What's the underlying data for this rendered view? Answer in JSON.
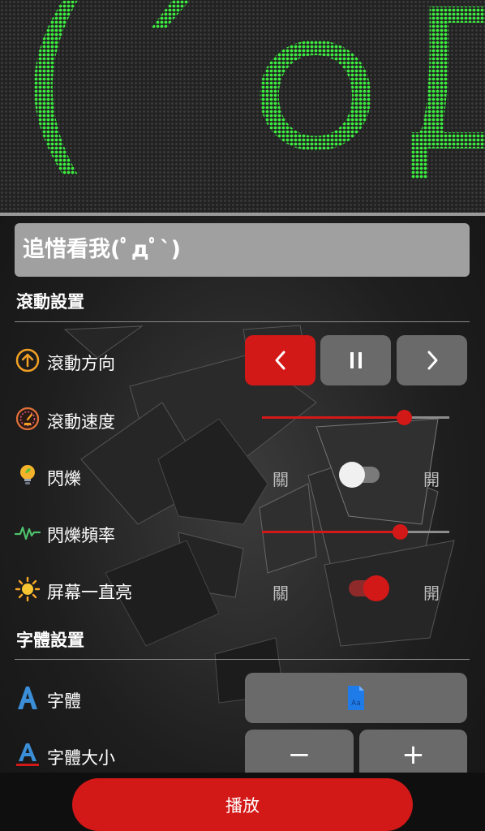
{
  "led_display": {
    "text": "(´ｏДｏ`)"
  },
  "message_input": {
    "value": "追惜看我(ﾟдﾟ`)"
  },
  "scroll_settings": {
    "title": "滾動設置",
    "direction": {
      "label": "滾動方向",
      "selected": "left"
    },
    "speed": {
      "label": "滾動速度",
      "value": 0.8
    },
    "blink": {
      "label": "閃爍",
      "off_label": "關",
      "on_label": "開",
      "state": "off"
    },
    "blink_freq": {
      "label": "閃爍頻率",
      "value": 0.74
    },
    "screen_on": {
      "label": "屏幕一直亮",
      "off_label": "關",
      "on_label": "開",
      "state": "on"
    }
  },
  "font_settings": {
    "title": "字體設置",
    "font": {
      "label": "字體",
      "icon": "font-file-icon",
      "icon_text": "Aa"
    },
    "font_size": {
      "label": "字體大小",
      "minus": "−",
      "plus": "+"
    }
  },
  "play_button": {
    "label": "播放"
  },
  "colors": {
    "accent": "#d31818",
    "led_green": "#3df040",
    "input_bg": "#a0a0a0"
  }
}
